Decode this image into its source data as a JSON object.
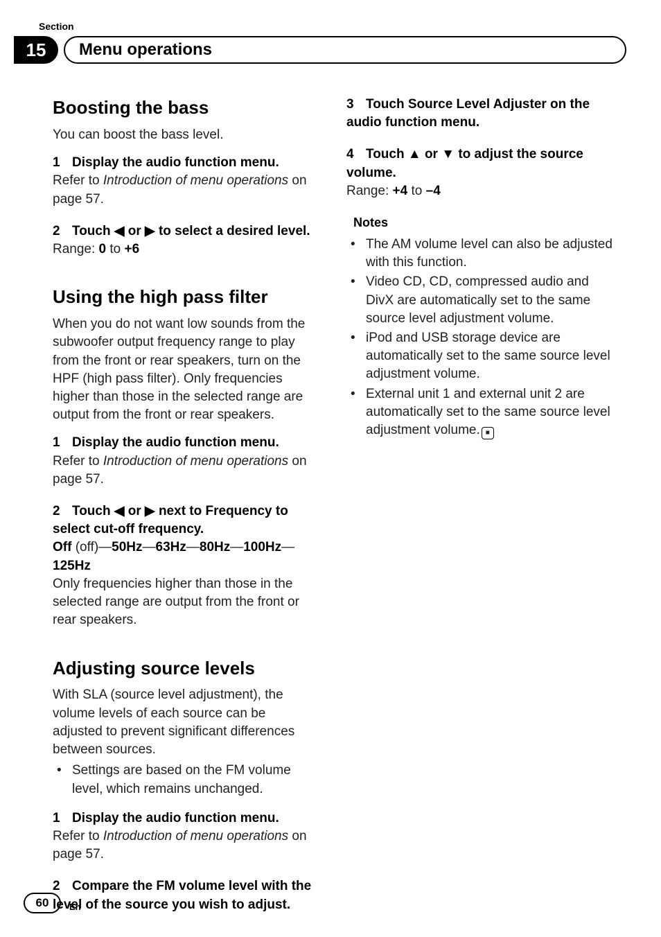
{
  "header": {
    "section_label": "Section",
    "section_number": "15",
    "title": "Menu operations"
  },
  "left": {
    "s1": {
      "heading": "Boosting the bass",
      "intro": "You can boost the bass level.",
      "step1_num": "1",
      "step1_text": "Display the audio function menu.",
      "step1_body_a": "Refer to ",
      "step1_body_italic": "Introduction of menu operations",
      "step1_body_b": " on page 57.",
      "step2_num": "2",
      "step2_pre": "Touch ",
      "left_arrow": "◀",
      "or": " or ",
      "right_arrow": "▶",
      "step2_post": " to select a desired level.",
      "range_label": "Range: ",
      "range_a": "0",
      "range_to": " to ",
      "range_b": "+6"
    },
    "s2": {
      "heading": "Using the high pass filter",
      "intro": "When you do not want low sounds from the subwoofer output frequency range to play from the front or rear speakers, turn on the HPF (high pass filter). Only frequencies higher than those in the selected range are output from the front or rear speakers.",
      "step1_num": "1",
      "step1_text": "Display the audio function menu.",
      "step1_body_a": "Refer to ",
      "step1_body_italic": "Introduction of menu operations",
      "step1_body_b": " on page 57.",
      "step2_num": "2",
      "step2_pre": "Touch ",
      "left_arrow": "◀",
      "or": " or ",
      "right_arrow": "▶",
      "step2_post": " next to Frequency to select cut-off frequency.",
      "opts_off": "Off",
      "opts_off_paren": " (off)",
      "dash": "—",
      "o1": "50Hz",
      "o2": "63Hz",
      "o3": "80Hz",
      "o4": "100Hz",
      "o5": "125Hz",
      "after_opts": "Only frequencies higher than those in the selected range are output from the front or rear speakers."
    },
    "s3": {
      "heading": "Adjusting source levels",
      "intro": "With SLA (source level adjustment), the volume levels of each source can be adjusted to prevent significant differences between sources.",
      "bullet1": "Settings are based on the FM volume level, which remains unchanged.",
      "step1_num": "1",
      "step1_text": "Display the audio function menu.",
      "step1_body_a": "Refer to ",
      "step1_body_italic": "Introduction of menu operations",
      "step1_body_b": " on page 57.",
      "step2_num": "2",
      "step2_text": "Compare the FM volume level with the level of the source you wish to adjust."
    }
  },
  "right": {
    "step3_num": "3",
    "step3_text": "Touch Source Level Adjuster on the audio function menu.",
    "step4_num": "4",
    "step4_pre": "Touch ",
    "up_arrow": "▲",
    "or": " or ",
    "down_arrow": "▼",
    "step4_post": " to adjust the source volume.",
    "range_label": "Range: ",
    "range_a": "+4",
    "range_to": " to ",
    "range_b": "–4",
    "notes_label": "Notes",
    "n1": "The AM volume level can also be adjusted with this function.",
    "n2": "Video CD, CD, compressed audio and DivX are automatically set to the same source level adjustment volume.",
    "n3": "iPod and USB storage device are automatically set to the same source level adjustment volume.",
    "n4": "External unit 1 and external unit 2 are automatically set to the same source level adjustment volume.",
    "end_glyph": "■"
  },
  "footer": {
    "page_number": "60",
    "lang": "En"
  }
}
